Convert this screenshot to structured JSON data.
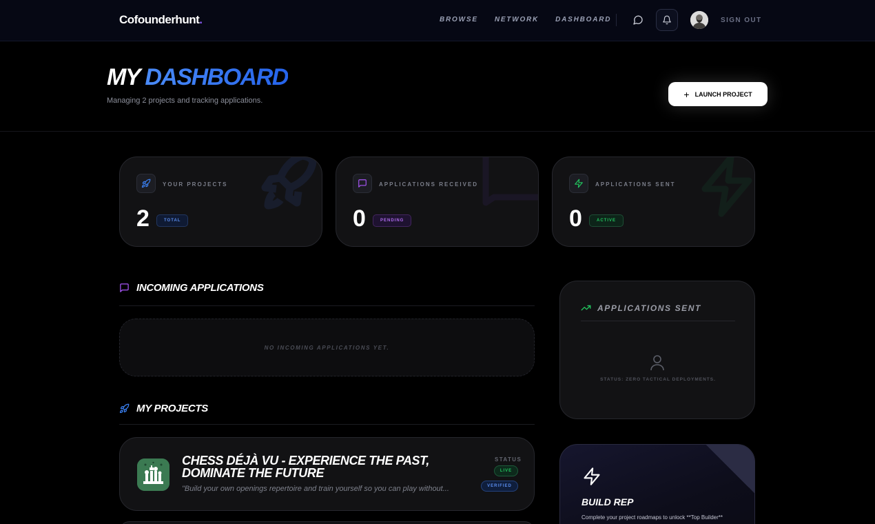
{
  "nav": {
    "brand": "Cofounderhunt",
    "brand_dot": ".",
    "links": [
      "BROWSE",
      "NETWORK",
      "DASHBOARD"
    ],
    "sign_out": "SIGN OUT"
  },
  "hero": {
    "title_main": "MY",
    "title_accent": "DASHBOARD",
    "subtitle": "Managing 2 projects and tracking applications.",
    "launch_plus": "+",
    "launch_label": "LAUNCH PROJECT"
  },
  "stats": [
    {
      "label": "YOUR PROJECTS",
      "value": "2",
      "badge": "TOTAL",
      "icon": "rocket-icon",
      "color": "#3b82f6"
    },
    {
      "label": "APPLICATIONS RECEIVED",
      "value": "0",
      "badge": "PENDING",
      "icon": "message-icon",
      "color": "#a855f7"
    },
    {
      "label": "APPLICATIONS SENT",
      "value": "0",
      "badge": "ACTIVE",
      "icon": "bolt-icon",
      "color": "#22c55e"
    }
  ],
  "incoming": {
    "title": "INCOMING APPLICATIONS",
    "empty": "NO INCOMING APPLICATIONS YET."
  },
  "projects": {
    "title": "MY PROJECTS",
    "items": [
      {
        "title": "CHESS DÉJÀ VU - EXPERIENCE THE PAST, DOMINATE THE FUTURE",
        "description": "\"Build your own openings repertoire and train yourself so you can play without...",
        "status_label": "STATUS",
        "status": "LIVE",
        "verified": "VERIFIED"
      }
    ]
  },
  "sent_panel": {
    "title": "APPLICATIONS SENT",
    "status": "STATUS: ZERO TACTICAL DEPLOYMENTS."
  },
  "rep": {
    "title": "BUILD REP",
    "description": "Complete your project roadmaps to unlock **Top Builder**"
  }
}
